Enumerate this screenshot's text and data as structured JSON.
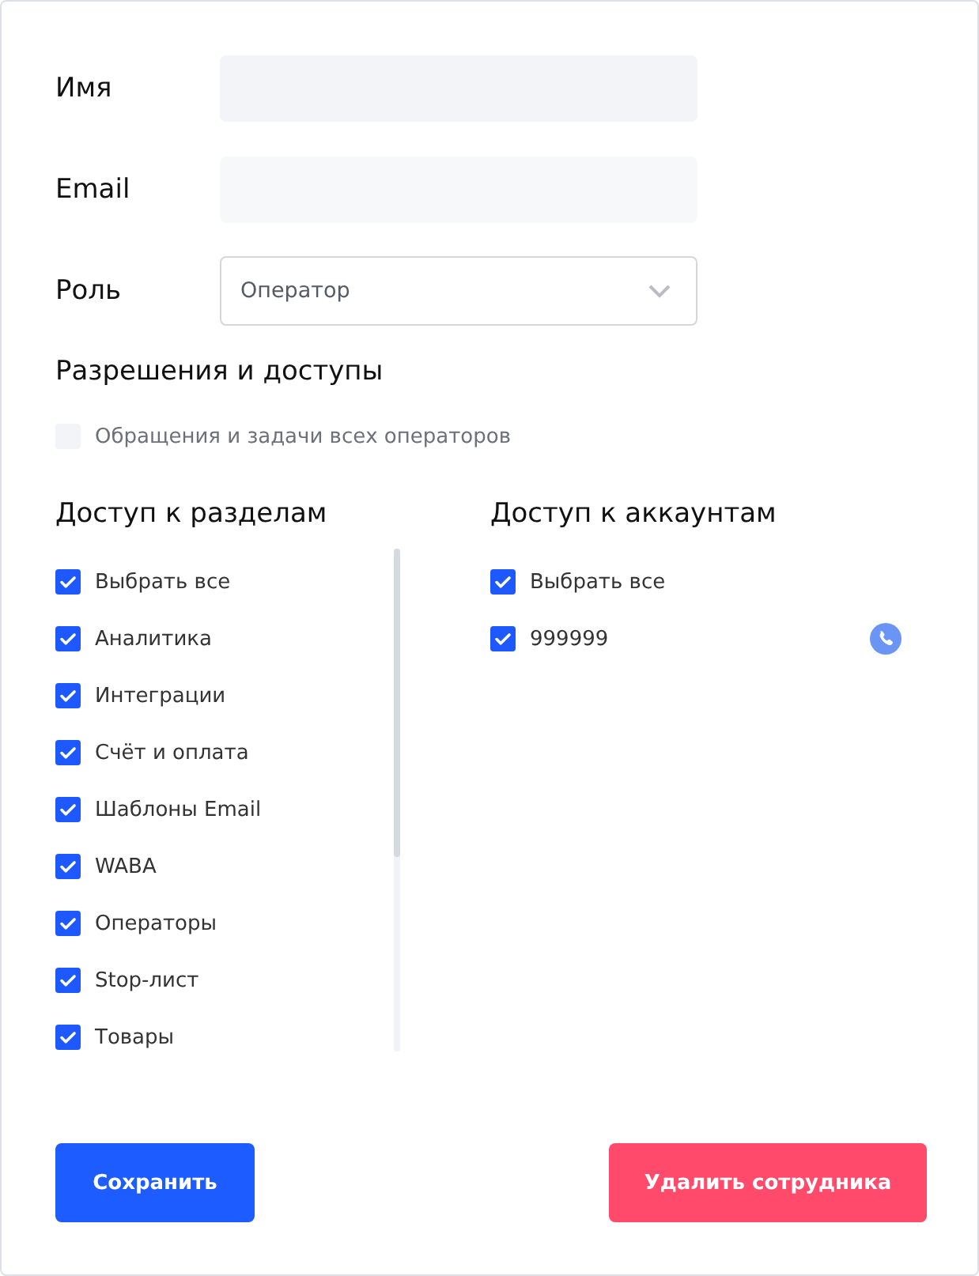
{
  "fields": [
    {
      "label": "Имя",
      "kind": "text"
    },
    {
      "label": "Email",
      "kind": "text"
    },
    {
      "label": "Роль",
      "kind": "select",
      "value": "Оператор"
    }
  ],
  "permissions": {
    "title": "Разрешения и доступы",
    "all_operators": {
      "label": "Обращения и задачи всех операторов",
      "checked": false
    }
  },
  "sections": {
    "title": "Доступ к разделам",
    "items": [
      {
        "label": "Выбрать все",
        "checked": true
      },
      {
        "label": "Аналитика",
        "checked": true
      },
      {
        "label": "Интеграции",
        "checked": true
      },
      {
        "label": "Счёт и оплата",
        "checked": true
      },
      {
        "label": "Шаблоны Email",
        "checked": true
      },
      {
        "label": "WABA",
        "checked": true
      },
      {
        "label": "Операторы",
        "checked": true
      },
      {
        "label": "Stop-лист",
        "checked": true
      },
      {
        "label": "Товары",
        "checked": true
      }
    ]
  },
  "accounts": {
    "title": "Доступ к аккаунтам",
    "items": [
      {
        "label": "Выбрать все",
        "checked": true,
        "phone": false
      },
      {
        "label": "999999",
        "checked": true,
        "phone": true
      }
    ]
  },
  "buttons": [
    {
      "label": "Сохранить",
      "kind": "primary"
    },
    {
      "label": "Удалить сотрудника",
      "kind": "danger"
    }
  ]
}
